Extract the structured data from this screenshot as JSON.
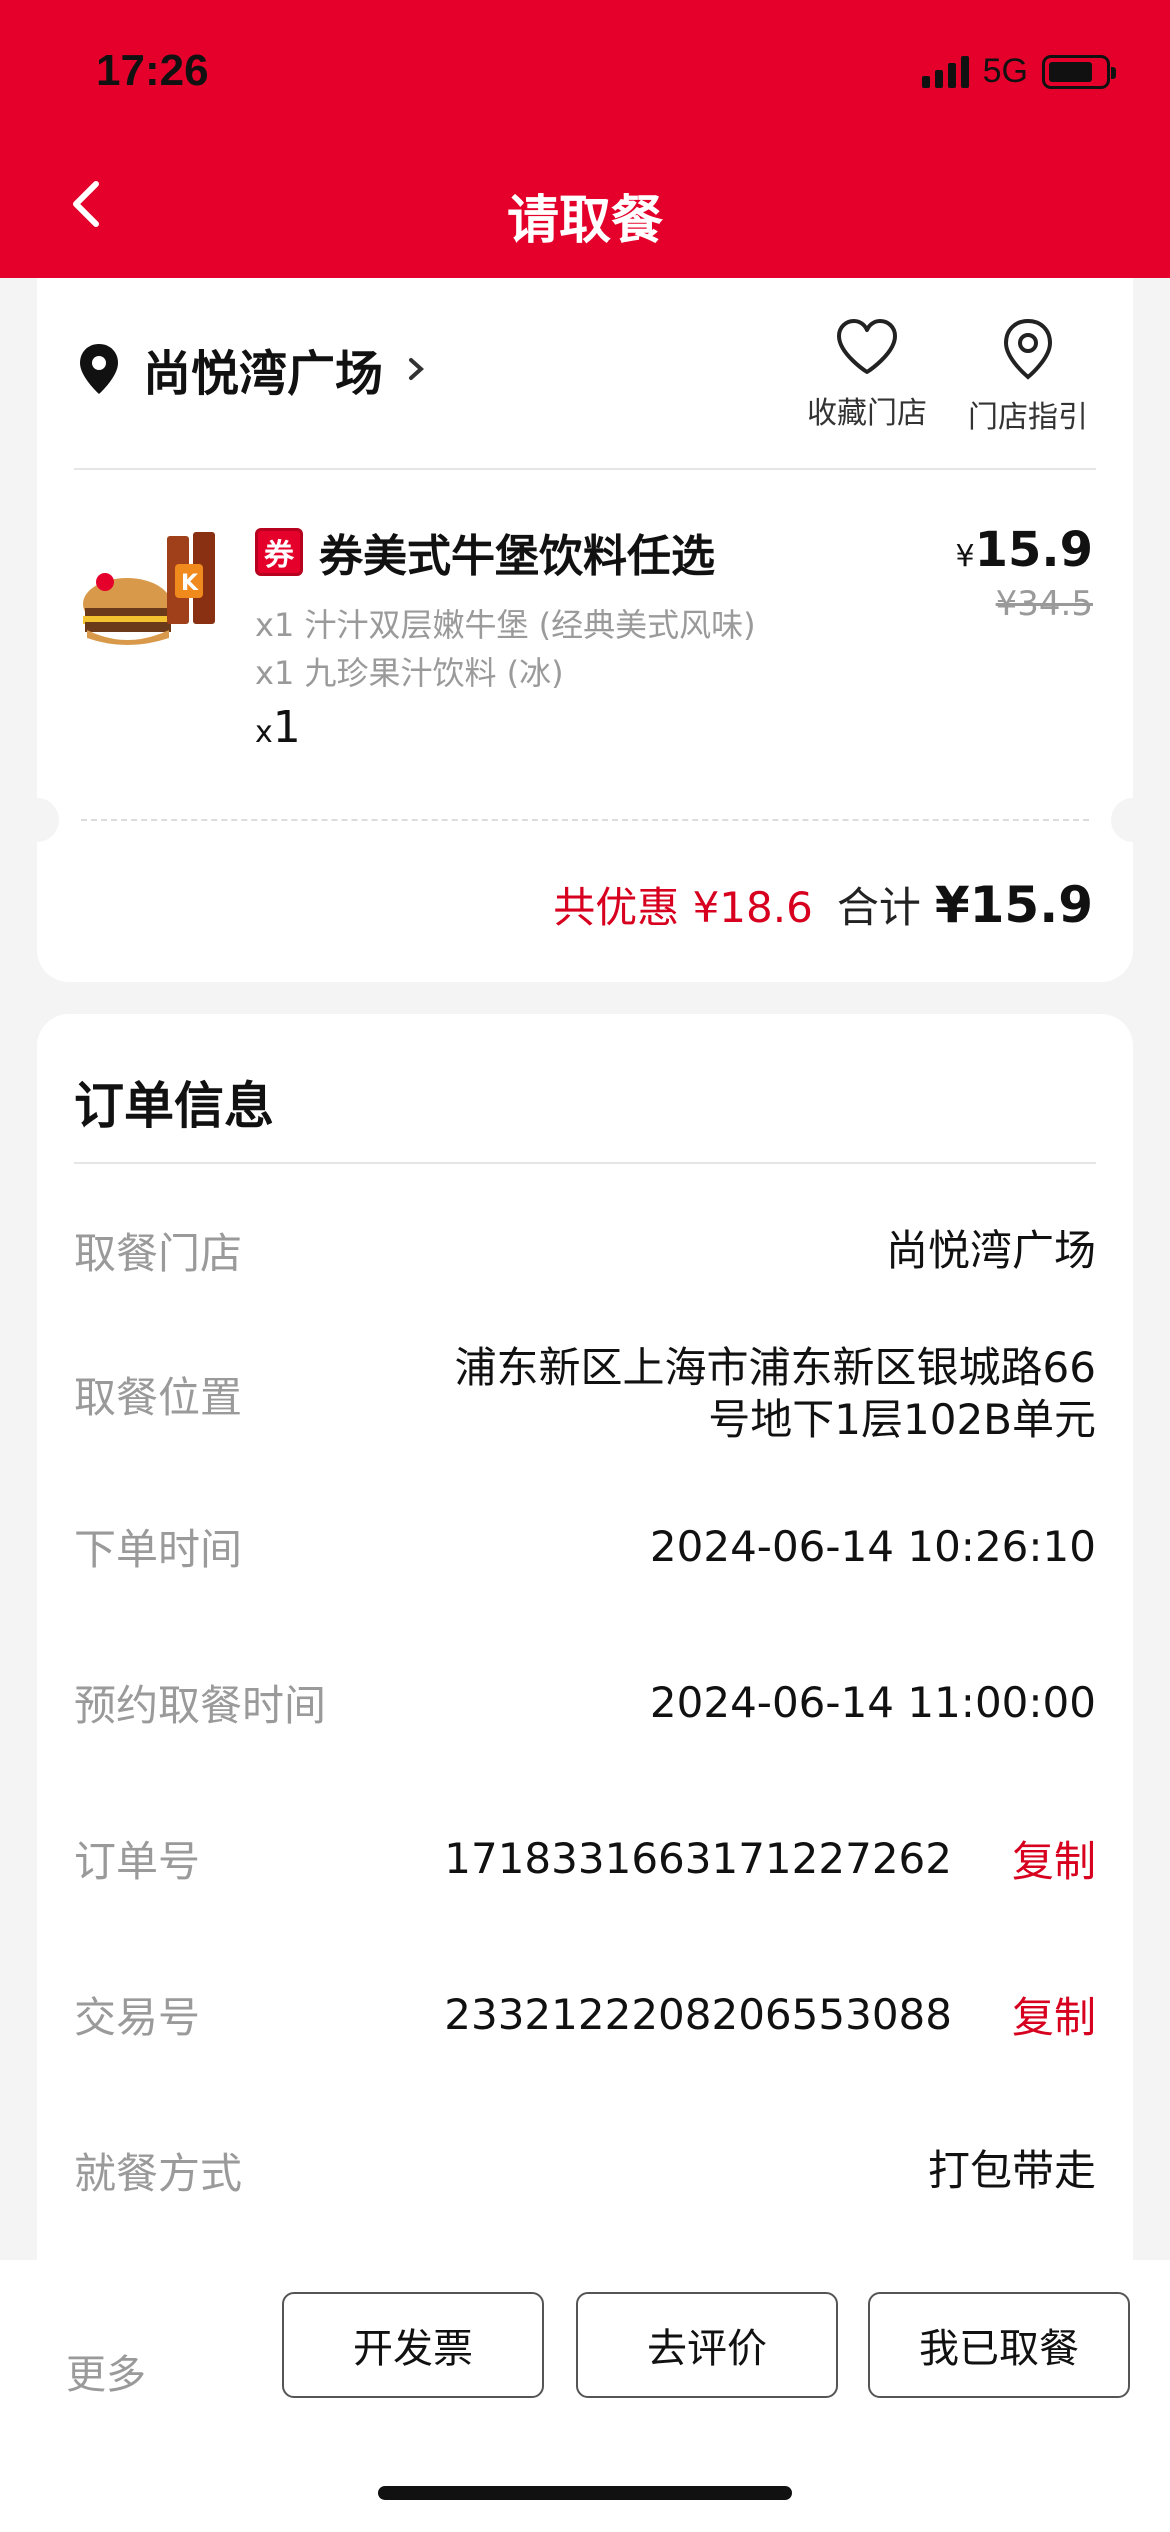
{
  "status": {
    "time": "17:26",
    "network": "5G"
  },
  "header": {
    "title": "请取餐"
  },
  "store": {
    "name": "尚悦湾广场",
    "favorite_label": "收藏门店",
    "guide_label": "门店指引"
  },
  "item": {
    "tag": "券",
    "name": "券美式牛堡饮料任选",
    "sub_items": [
      "x1 汁汁双层嫩牛堡 (经典美式风味)",
      "x1 九珍果汁饮料 (冰)"
    ],
    "qty_prefix": "x",
    "qty": "1",
    "currency": "¥",
    "price": "15.9",
    "original_price": "¥34.5"
  },
  "totals": {
    "discount": "共优惠 ¥18.6",
    "sum_label": "合计",
    "sum_value": "¥15.9"
  },
  "order_info": {
    "title": "订单信息",
    "rows": [
      {
        "label": "取餐门店",
        "value": "尚悦湾广场"
      },
      {
        "label": "取餐位置",
        "value_line1": "浦东新区上海市浦东新区银城路66",
        "value_line2": "号地下1层102B单元"
      },
      {
        "label": "下单时间",
        "value": "2024-06-14 10:26:10"
      },
      {
        "label": "预约取餐时间",
        "value": "2024-06-14 11:00:00"
      },
      {
        "label": "订单号",
        "value": "1718331663171227262",
        "action": "复制"
      },
      {
        "label": "交易号",
        "value": "2332122208206553088",
        "action": "复制"
      },
      {
        "label": "就餐方式",
        "value": "打包带走"
      }
    ]
  },
  "bottom": {
    "more": "更多",
    "invoice": "开发票",
    "review": "去评价",
    "picked_up": "我已取餐"
  },
  "colors": {
    "brand": "#e4002b",
    "accent_text": "#d7001e"
  }
}
